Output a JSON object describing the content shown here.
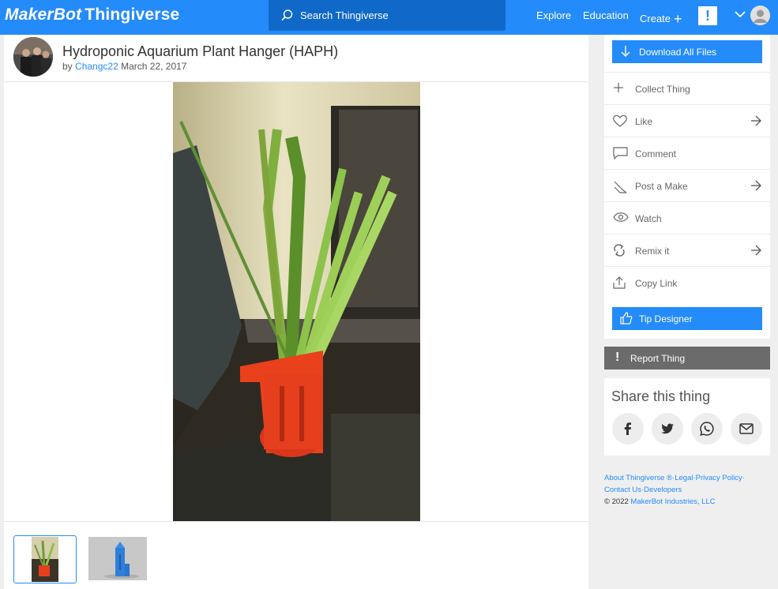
{
  "header": {
    "logo_makerbot": "MakerBot",
    "logo_thingiverse": "Thingiverse",
    "search_placeholder": "Search Thingiverse",
    "nav": {
      "explore": "Explore",
      "education": "Education",
      "create": "Create",
      "create_plus": "+"
    },
    "notification_glyph": "!"
  },
  "thing": {
    "title": "Hydroponic Aquarium Plant Hanger (HAPH)",
    "by": "by",
    "author": "Changc22",
    "date": "March 22, 2017"
  },
  "actions": {
    "download_all": "Download All Files",
    "collect": "Collect Thing",
    "like": "Like",
    "comment": "Comment",
    "post_make": "Post a Make",
    "watch": "Watch",
    "remix": "Remix it",
    "copy_link": "Copy Link",
    "tip_designer": "Tip Designer"
  },
  "report": {
    "glyph": "!",
    "label": "Report Thing"
  },
  "share": {
    "title": "Share this thing",
    "icons": [
      "facebook-icon",
      "twitter-icon",
      "whatsapp-icon",
      "email-icon"
    ]
  },
  "footer": {
    "about": "About Thingiverse",
    "registered": "®",
    "sep1": "·",
    "legal": "Legal",
    "sep2": "·",
    "privacy": "Privacy Policy",
    "sep3": "·",
    "contact": "Contact Us",
    "sep4": "·",
    "developers": "Developers",
    "copyright": "© 2022",
    "company": "MakerBot Industries, LLC"
  },
  "colors": {
    "brand_blue": "#248bfb",
    "search_dark": "#1069c9",
    "report_gray": "#6b6b6b"
  }
}
